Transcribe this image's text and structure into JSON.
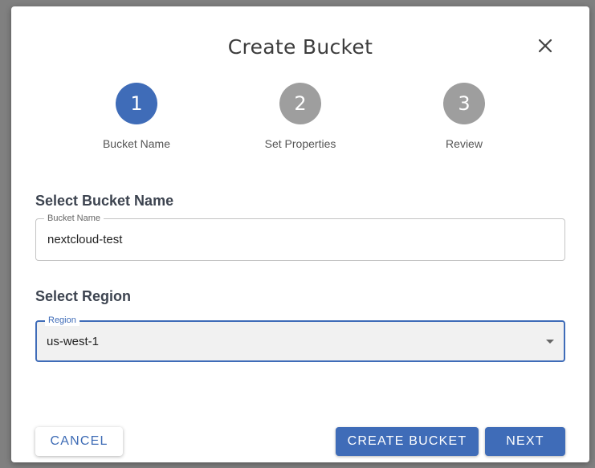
{
  "dialog": {
    "title": "Create Bucket",
    "close_icon": "close-icon"
  },
  "stepper": {
    "steps": [
      {
        "number": "1",
        "label": "Bucket Name",
        "state": "active"
      },
      {
        "number": "2",
        "label": "Set Properties",
        "state": "inactive"
      },
      {
        "number": "3",
        "label": "Review",
        "state": "inactive"
      }
    ]
  },
  "bucket_name": {
    "section_title": "Select Bucket Name",
    "legend": "Bucket Name",
    "value": "nextcloud-test"
  },
  "region": {
    "section_title": "Select Region",
    "legend": "Region",
    "value": "us-west-1",
    "arrow_icon": "dropdown-arrow-icon"
  },
  "actions": {
    "cancel_label": "CANCEL",
    "create_label": "CREATE BUCKET",
    "next_label": "NEXT"
  },
  "colors": {
    "accent": "#3f6cb8",
    "step_active": "#3f6cb8",
    "step_inactive": "#9e9e9e",
    "overlay": "#808080"
  }
}
